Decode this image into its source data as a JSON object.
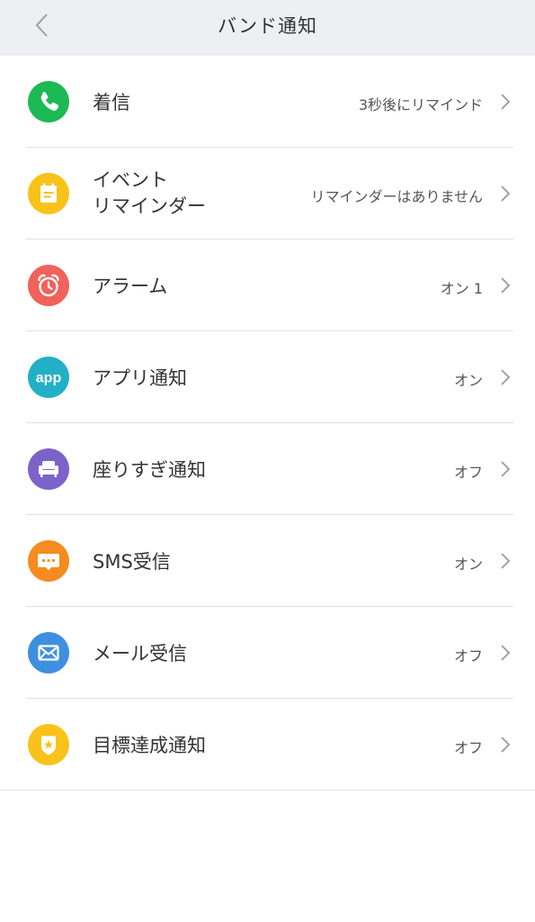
{
  "header": {
    "title": "バンド通知"
  },
  "colors": {
    "call": "#1db954",
    "event": "#f9c21b",
    "alarm": "#f0625a",
    "app": "#22b0c6",
    "sitting": "#7c63c9",
    "sms": "#f68b1f",
    "mail": "#3f8fe0",
    "goal": "#f9c21b"
  },
  "items": [
    {
      "id": "call",
      "icon": "phone-icon",
      "label": "着信",
      "value": "3秒後にリマインド"
    },
    {
      "id": "event",
      "icon": "calendar-icon",
      "label_line1": "イベント",
      "label_line2": "リマインダー",
      "value": "リマインダーはありません"
    },
    {
      "id": "alarm",
      "icon": "alarm-clock-icon",
      "label": "アラーム",
      "value": "オン 1"
    },
    {
      "id": "app",
      "icon": "app-icon",
      "icon_text": "app",
      "label": "アプリ通知",
      "value": "オン"
    },
    {
      "id": "sitting",
      "icon": "sofa-icon",
      "label": "座りすぎ通知",
      "value": "オフ"
    },
    {
      "id": "sms",
      "icon": "message-icon",
      "label": "SMS受信",
      "value": "オン"
    },
    {
      "id": "mail",
      "icon": "mail-icon",
      "label": "メール受信",
      "value": "オフ"
    },
    {
      "id": "goal",
      "icon": "goal-badge-icon",
      "label": "目標達成通知",
      "value": "オフ"
    }
  ]
}
